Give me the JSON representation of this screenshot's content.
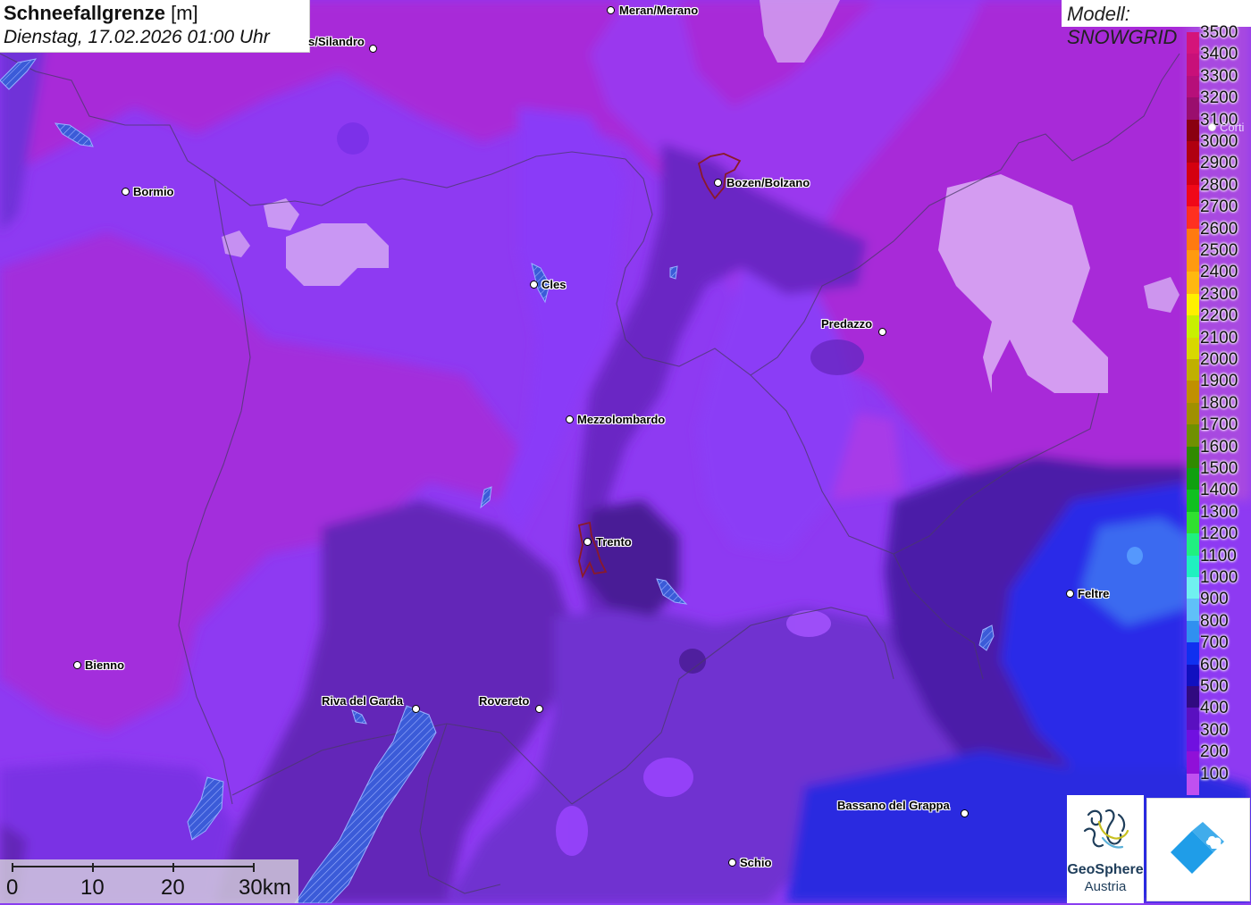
{
  "header": {
    "title": "Schneefallgrenze",
    "unit": "[m]",
    "subtitle": "Dienstag, 17.02.2026 01:00 Uhr"
  },
  "model_label": "Modell: SNOWGRID",
  "legend": [
    {
      "label": "3500",
      "color": "#d4147a"
    },
    {
      "label": "3400",
      "color": "#c8107a"
    },
    {
      "label": "3300",
      "color": "#b60f7a"
    },
    {
      "label": "3200",
      "color": "#9a0e6e"
    },
    {
      "label": "3100",
      "color": "#8a0010"
    },
    {
      "label": "3000",
      "color": "#b00010"
    },
    {
      "label": "2900",
      "color": "#d40010"
    },
    {
      "label": "2800",
      "color": "#f00818"
    },
    {
      "label": "2700",
      "color": "#ff3020"
    },
    {
      "label": "2600",
      "color": "#ff7a10"
    },
    {
      "label": "2500",
      "color": "#ff9a10"
    },
    {
      "label": "2400",
      "color": "#ffb810"
    },
    {
      "label": "2300",
      "color": "#fff000"
    },
    {
      "label": "2200",
      "color": "#c8f000"
    },
    {
      "label": "2100",
      "color": "#d8d800"
    },
    {
      "label": "2000",
      "color": "#c0b000"
    },
    {
      "label": "1900",
      "color": "#c09000"
    },
    {
      "label": "1800",
      "color": "#a09000"
    },
    {
      "label": "1700",
      "color": "#709000"
    },
    {
      "label": "1600",
      "color": "#308a00"
    },
    {
      "label": "1500",
      "color": "#10a010"
    },
    {
      "label": "1400",
      "color": "#10c020"
    },
    {
      "label": "1300",
      "color": "#30e030"
    },
    {
      "label": "1200",
      "color": "#20f080"
    },
    {
      "label": "1100",
      "color": "#20f0c0"
    },
    {
      "label": "1000",
      "color": "#70f0f0"
    },
    {
      "label": "900",
      "color": "#60c0f8"
    },
    {
      "label": "800",
      "color": "#3090f0"
    },
    {
      "label": "700",
      "color": "#1030f0"
    },
    {
      "label": "600",
      "color": "#1010c0"
    },
    {
      "label": "500",
      "color": "#300a80"
    },
    {
      "label": "400",
      "color": "#5a10c0"
    },
    {
      "label": "300",
      "color": "#7010e0"
    },
    {
      "label": "200",
      "color": "#9010d8"
    },
    {
      "label": "100",
      "color": "#c050f0"
    }
  ],
  "cities": [
    {
      "name": "Meran/Merano"
    },
    {
      "name": "s/Silandro"
    },
    {
      "name": "Bormio"
    },
    {
      "name": "Bozen/Bolzano"
    },
    {
      "name": "Cles"
    },
    {
      "name": "Predazzo"
    },
    {
      "name": "Mezzolombardo"
    },
    {
      "name": "Trento"
    },
    {
      "name": "Feltre"
    },
    {
      "name": "Bienno"
    },
    {
      "name": "Riva del Garda"
    },
    {
      "name": "Rovereto"
    },
    {
      "name": "Bassano del Grappa"
    },
    {
      "name": "Schio"
    },
    {
      "name": "Corti"
    }
  ],
  "scalebar": {
    "labels": [
      "0",
      "10",
      "20",
      "30km"
    ]
  },
  "logo": {
    "line1": "GeoSphere",
    "line2": "Austria"
  }
}
